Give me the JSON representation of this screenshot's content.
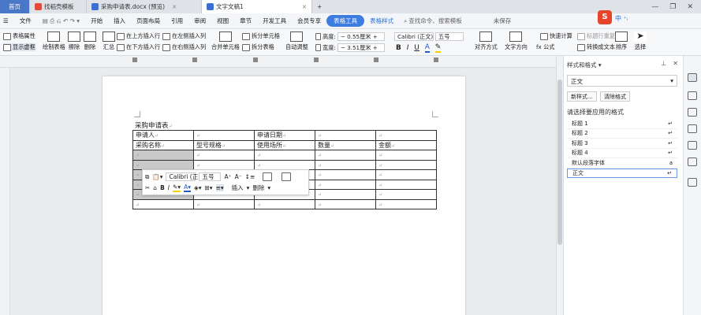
{
  "tabs": [
    {
      "label": "首页"
    },
    {
      "label": "找稻壳模板",
      "close": "×"
    },
    {
      "label": "采购申请表.docx (预览)",
      "close": "×"
    },
    {
      "label": "文字文稿1",
      "close": "×"
    },
    {
      "label": "+"
    }
  ],
  "window_controls": {
    "minimize": "—",
    "restore": "❐",
    "close": "✕"
  },
  "menu": {
    "file": "文件",
    "items": [
      "开始",
      "插入",
      "页面布局",
      "引用",
      "审阅",
      "视图",
      "章节",
      "开发工具",
      "会员专享"
    ],
    "context_tab_1": "表格工具",
    "context_tab_2": "表格样式",
    "search": "查找命令、搜索模板",
    "unsaved": "未保存",
    "tray_text": "中 ⁺ᵢ"
  },
  "ribbon": {
    "table_props": "表格属性",
    "show_gridlines": "显示虚框",
    "draw_table": "绘制表格",
    "erase": "擦除",
    "delete": "删除",
    "summary": "汇总",
    "insert_above": "在上方插入行",
    "insert_below": "在下方插入行",
    "insert_left": "在左侧插入列",
    "insert_right": "在右侧插入列",
    "merge_cells": "合并单元格",
    "split_cells": "拆分单元格",
    "split_table": "拆分表格",
    "auto_fit": "自动调整",
    "height_label": "高度:",
    "height_value": "0.55厘米",
    "width_label": "宽度:",
    "width_value": "3.51厘米",
    "font_name": "Calibri (正文)",
    "font_size": "五号",
    "align": "对齐方式",
    "text_direction": "文字方向",
    "formula": "fx 公式",
    "quick_calc": "快速计算",
    "repeat_header": "标题行重复",
    "convert_text": "转换成文本",
    "sort": "排序",
    "select": "选择"
  },
  "document": {
    "title": "采购申请表",
    "rows": [
      [
        "申请人",
        "",
        "申请日期",
        "",
        ""
      ],
      [
        "采购名称",
        "型号规格",
        "使用场所",
        "数量",
        "金额"
      ],
      [
        "",
        "",
        "",
        "",
        ""
      ],
      [
        "",
        "",
        "",
        "",
        ""
      ],
      [
        "",
        "",
        "",
        "",
        ""
      ],
      [
        "",
        "",
        "",
        "",
        ""
      ],
      [
        "",
        "",
        "",
        "",
        ""
      ],
      [
        "",
        "",
        "",
        "",
        ""
      ]
    ]
  },
  "mini_toolbar": {
    "font_name": "Calibri (正",
    "font_size": "五号",
    "insert": "插入",
    "delete": "删除"
  },
  "styles_panel": {
    "header": "样式和格式",
    "current": "正文",
    "new_style": "新样式...",
    "clear_format": "清除格式",
    "apply_label": "请选择要应用的格式",
    "items": [
      {
        "label": "标题 1",
        "mark": "↵"
      },
      {
        "label": "标题 2",
        "mark": "↵"
      },
      {
        "label": "标题 3",
        "mark": "↵"
      },
      {
        "label": "标题 4",
        "mark": "↵"
      },
      {
        "label": "默认段落字体",
        "mark": "a"
      },
      {
        "label": "正文",
        "mark": "↵"
      }
    ]
  }
}
